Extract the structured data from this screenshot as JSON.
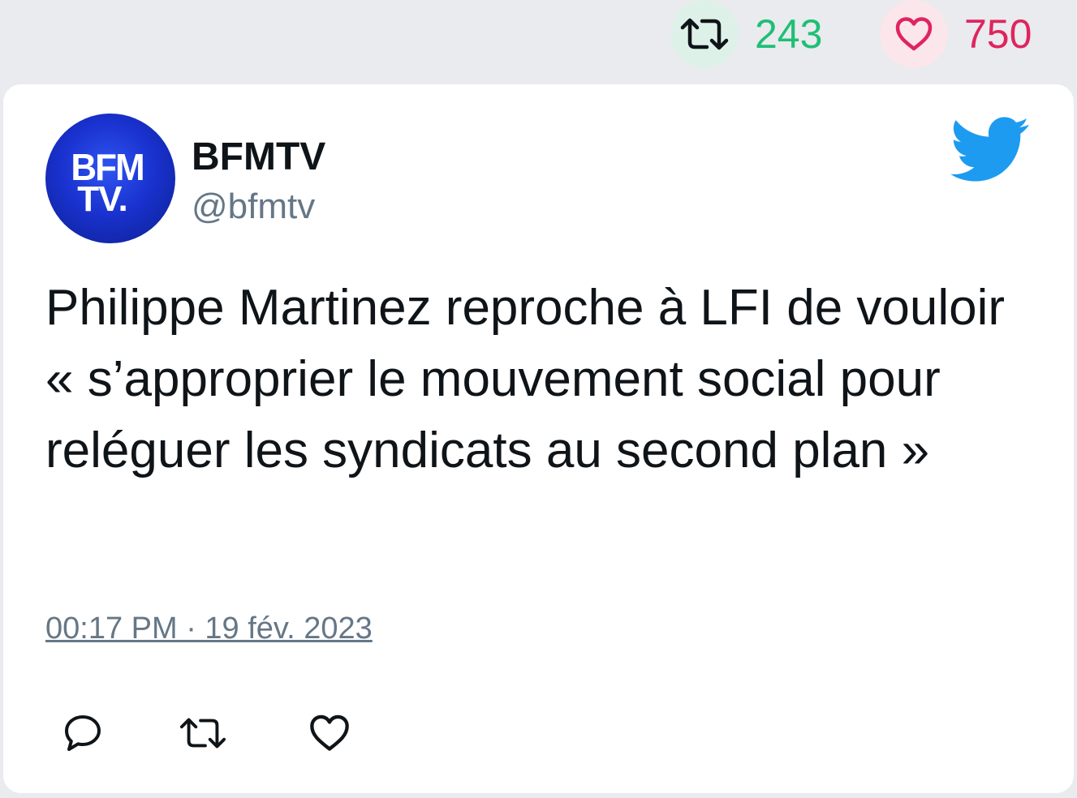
{
  "stats": {
    "retweet_count": "243",
    "like_count": "750",
    "retweet_color": "#1fbf76",
    "like_color": "#e0245e"
  },
  "author": {
    "name": "BFMTV",
    "handle": "@bfmtv",
    "avatar_logo_lines": [
      "BFM",
      "TV."
    ]
  },
  "tweet": {
    "text": "Philippe Martinez reproche à LFI de vouloir « s’approprier le mouvement social pour reléguer les syndicats au second plan »",
    "timestamp": "00:17 PM · 19 fév. 2023"
  },
  "icons": {
    "brand": "twitter-bird-icon",
    "actions": [
      "reply-icon",
      "retweet-icon",
      "like-icon"
    ],
    "brand_color": "#1d9bf0"
  }
}
